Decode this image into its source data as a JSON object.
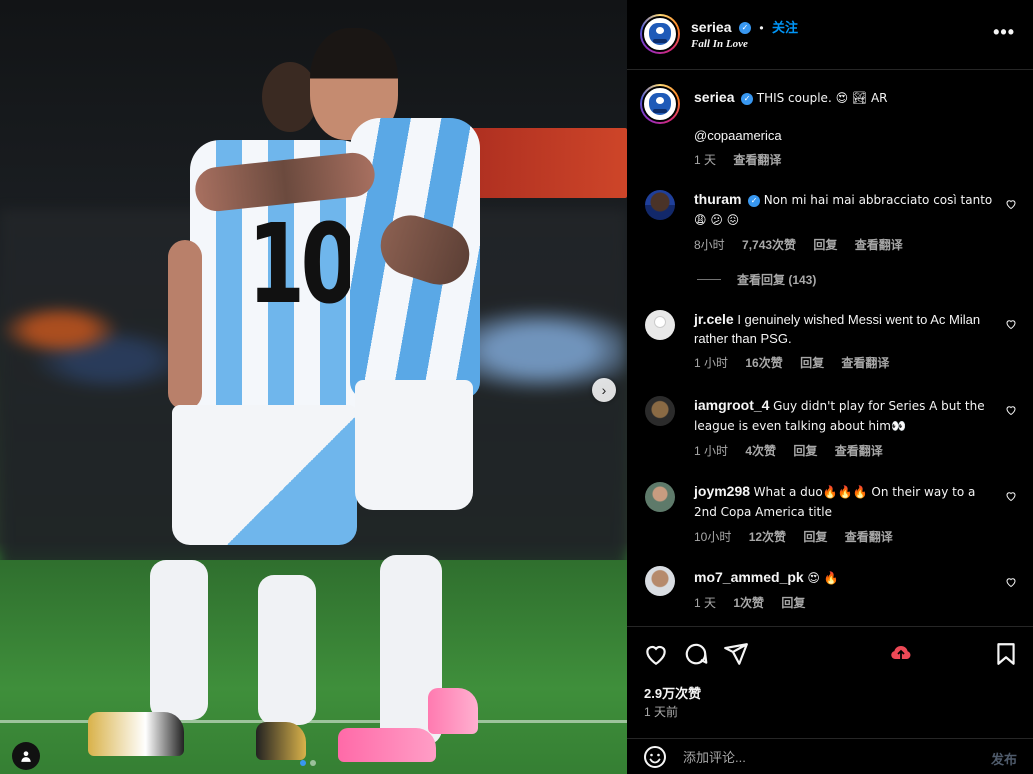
{
  "post": {
    "account": "seriea",
    "follow_label": "关注",
    "separator": "•",
    "subtitle": "Fall In Love",
    "more_label": "•••"
  },
  "caption": {
    "username": "seriea",
    "text": "THIS couple. 😍 🏞 AR",
    "mention": "@copaamerica",
    "time": "1 天",
    "translate": "查看翻译"
  },
  "comments": [
    {
      "username": "thuram",
      "verified": true,
      "text": "Non mi hai mai abbracciato così tanto 😩 😕 😖",
      "time": "8小时",
      "likes": "7,743次赞",
      "reply": "回复",
      "translate": "查看翻译",
      "view_replies": "查看回复 (143)"
    },
    {
      "username": "jr.cele",
      "verified": false,
      "text": "I genuinely wished Messi went to Ac Milan rather than PSG.",
      "time": "1 小时",
      "likes": "16次赞",
      "reply": "回复",
      "translate": "查看翻译"
    },
    {
      "username": "iamgroot_4",
      "verified": false,
      "text": "Guy didn't play for Series A but the league is even talking about him👀",
      "time": "1 小时",
      "likes": "4次赞",
      "reply": "回复",
      "translate": "查看翻译"
    },
    {
      "username": "joym298",
      "verified": false,
      "text": "What a duo🔥🔥🔥 On their way to a 2nd Copa America title",
      "time": "10小时",
      "likes": "12次赞",
      "reply": "回复",
      "translate": "查看翻译"
    },
    {
      "username": "mo7_ammed_pk",
      "verified": false,
      "text": "😍 🔥",
      "time": "1 天",
      "likes": "1次赞",
      "reply": "回复"
    }
  ],
  "actions": {
    "likes_count": "2.9万次赞",
    "date": "1 天前",
    "comment_placeholder": "添加评论...",
    "post_label": "发布"
  },
  "photo": {
    "shirt_number": "10",
    "carousel_next": "›"
  },
  "colors": {
    "accent": "#0095f6",
    "panel_bg": "#000000",
    "divider": "#262626",
    "muted": "#a8a8a8",
    "like_red": "#ed4956"
  },
  "icons": [
    "heart-icon",
    "comment-icon",
    "share-icon",
    "like-icon",
    "bookmark-icon",
    "emoji-icon",
    "tag-people-icon",
    "more-icon",
    "verified-icon",
    "chevron-right-icon"
  ]
}
